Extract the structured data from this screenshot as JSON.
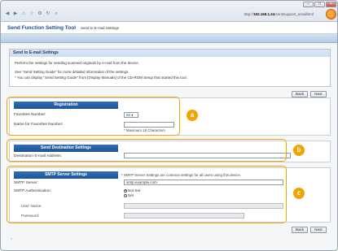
{
  "browser": {
    "url_prefix": "http://",
    "url_host": "192.168.1.24",
    "url_path": "/sendsupport_emailhtml",
    "nav_icons": [
      "back-arrow-icon",
      "forward-arrow-icon",
      "home-icon",
      "star-icon",
      "gear-icon",
      "refresh-icon",
      "search-icon"
    ],
    "go_glyph": "→"
  },
  "header": {
    "title": "Send Function Setting Tool",
    "breadcrumb": "Send to E-mail Settings"
  },
  "info": {
    "title": "Send to E-mail Settings",
    "line1": "Perform the settings for sending scanned originals by e-mail from the device.",
    "line2": "See \"Send Setting Guide\" for more detailed information of the settings.",
    "line3": "* You can display \"Send Setting Guide\" from [Display Manuals] of the CD-ROM Setup that started this tool."
  },
  "buttons": {
    "back": "Back",
    "next": "Next"
  },
  "registration": {
    "heading": "Registration",
    "favorites_number_label": "Favorites Number:",
    "favorites_number_value": "02",
    "name_label": "Name for Favorites Number:",
    "name_value": "",
    "name_note": "* Maximum 16 Characters",
    "callout": "a"
  },
  "destination": {
    "heading": "Send Destination Settings",
    "address_label": "Destination E-mail Address:",
    "address_value": "",
    "callout": "b"
  },
  "smtp": {
    "heading": "SMTP Server Settings",
    "note": "* SMTP Server Settings are common settings for all users using this device.",
    "server_label": "SMTP Server:",
    "server_value": "smtp.example.com",
    "auth_label": "SMTP Authentication:",
    "auth_options": [
      "Not Set",
      "Set"
    ],
    "auth_selected": "Not Set",
    "username_label": "User Name:",
    "password_label": "Password:",
    "callout": "c"
  },
  "footer_mark": "⌃",
  "colors": {
    "accent": "#f0a500",
    "section_header": "#1d5396",
    "title": "#1d4e8a"
  }
}
